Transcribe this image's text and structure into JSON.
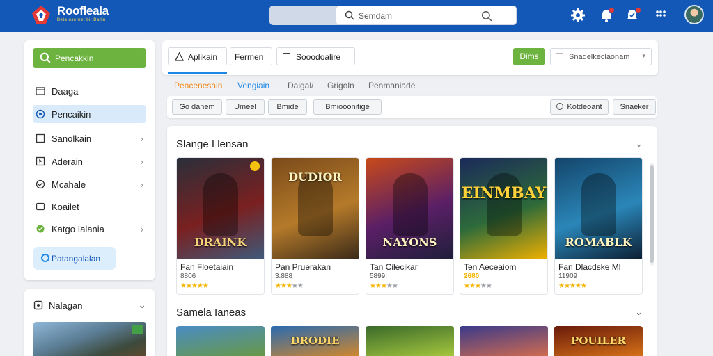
{
  "app": {
    "brand": "Roofleala",
    "brand_sub": "Beta usernet bit Ballin"
  },
  "search": {
    "placeholder": "Semdam"
  },
  "sidebar": {
    "top_button": "Pencakkin",
    "items": [
      {
        "label": "Daaga",
        "icon": "folder-icon",
        "chevron": false,
        "active": false
      },
      {
        "label": "Pencaikin",
        "icon": "target-icon",
        "chevron": false,
        "active": true
      },
      {
        "label": "Sanolkain",
        "icon": "square-icon",
        "chevron": true,
        "active": false
      },
      {
        "label": "Aderain",
        "icon": "pointer-icon",
        "chevron": true,
        "active": false
      },
      {
        "label": "Mcahale",
        "icon": "check-icon",
        "chevron": true,
        "active": false
      },
      {
        "label": "Koailet",
        "icon": "box-icon",
        "chevron": false,
        "active": false
      },
      {
        "label": "Katgo Ialania",
        "icon": "puzzle-icon",
        "chevron": true,
        "active": false
      }
    ],
    "bottom_button": "Patangalalan",
    "panel2_title": "Nalagan"
  },
  "main": {
    "tabs": [
      {
        "label": "Aplikain",
        "active": true
      },
      {
        "label": "Fermen"
      },
      {
        "label": "Sooodoalire"
      }
    ],
    "action_button": "Dims",
    "select_label": "Snadelkeclaonam",
    "subtabs": [
      "Pencenesain",
      "Vengiain",
      "Daigal/",
      "Grigoln",
      "Penmaniade"
    ],
    "filters": [
      "Go danem",
      "Umeel",
      "Bmide",
      "Bmiooonitige"
    ],
    "filters_right": [
      "Kotdeoant",
      "Snaeker"
    ]
  },
  "sections": [
    {
      "title": "Slange I lensan"
    },
    {
      "title": "Samela Ianeas"
    }
  ],
  "games": [
    {
      "name": "Fan Floetaiain",
      "meta": "8806",
      "rating": 5,
      "art_title": "DRAINK",
      "palette": [
        "#2a2f3a",
        "#7a2020",
        "#3f5a7a"
      ],
      "verified": true
    },
    {
      "name": "Pan Pruerakan",
      "meta": "3.888",
      "rating": 3,
      "art_title": "DUDIOR",
      "palette": [
        "#7a4a1a",
        "#b57a2a",
        "#3a2a18"
      ],
      "verified": false
    },
    {
      "name": "Tan Cilecikar",
      "meta": "5899!",
      "rating": 3,
      "art_title": "NAYONS",
      "palette": [
        "#c84a1a",
        "#5a1f66",
        "#1f1f3a"
      ],
      "verified": false
    },
    {
      "name": "Ten Aeceaiom",
      "meta": "2680",
      "rating": 3,
      "art_title": "EINMBAY",
      "palette": [
        "#1b2a5a",
        "#2d6a3a",
        "#f0b000"
      ],
      "verified": false
    },
    {
      "name": "Fan Dlacdske Ml",
      "meta": "11909",
      "rating": 5,
      "art_title": "ROMABLK",
      "palette": [
        "#14456a",
        "#2a86b8",
        "#0d1f33"
      ],
      "verified": false
    }
  ],
  "games_row2": [
    {
      "art_title": "",
      "palette": [
        "#4a8cc4",
        "#6b9a3a"
      ]
    },
    {
      "art_title": "DRODIE",
      "palette": [
        "#2a6ab0",
        "#e08a20"
      ]
    },
    {
      "art_title": "",
      "palette": [
        "#3a6a2a",
        "#b0d040"
      ]
    },
    {
      "art_title": "",
      "palette": [
        "#3a3a8a",
        "#e0704a"
      ]
    },
    {
      "art_title": "POUILER",
      "palette": [
        "#6a1a0a",
        "#e07a1a"
      ]
    }
  ]
}
